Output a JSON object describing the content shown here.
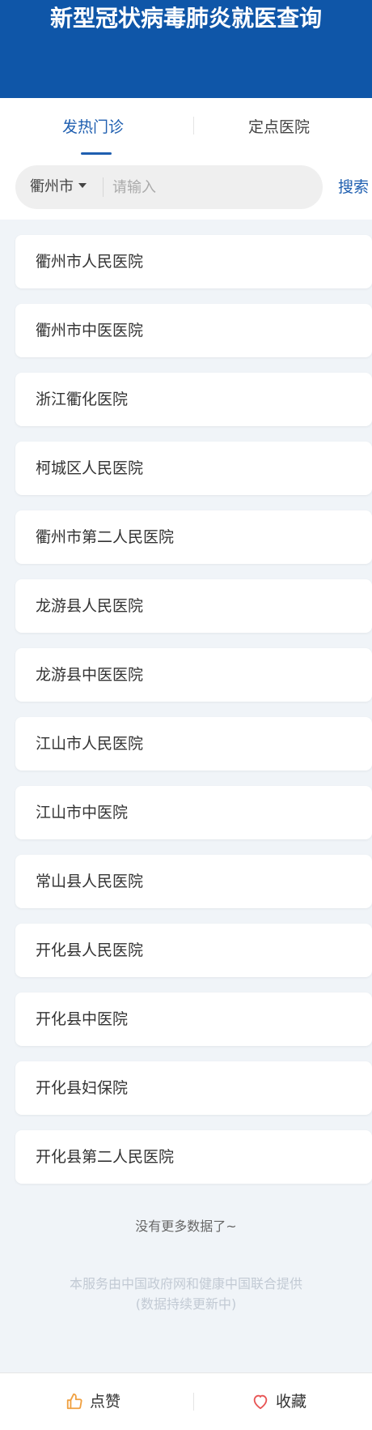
{
  "header": {
    "title": "新型冠状病毒肺炎就医查询"
  },
  "tabs": [
    {
      "label": "发热门诊",
      "active": true
    },
    {
      "label": "定点医院",
      "active": false
    }
  ],
  "search": {
    "city": "衢州市",
    "placeholder": "请输入",
    "value": "",
    "button_label": "搜索"
  },
  "hospitals": [
    "衢州市人民医院",
    "衢州市中医医院",
    "浙江衢化医院",
    "柯城区人民医院",
    "衢州市第二人民医院",
    "龙游县人民医院",
    "龙游县中医医院",
    "江山市人民医院",
    "江山市中医院",
    "常山县人民医院",
    "开化县人民医院",
    "开化县中医院",
    "开化县妇保院",
    "开化县第二人民医院"
  ],
  "list_end_text": "没有更多数据了~",
  "footer": {
    "line1": "本服务由中国政府网和健康中国联合提供",
    "line2": "(数据持续更新中)"
  },
  "bottom_bar": {
    "like_label": "点赞",
    "favorite_label": "收藏"
  },
  "colors": {
    "brand_blue": "#0f56a8",
    "accent_blue": "#1f5fb0",
    "like_icon": "#f0a040",
    "favorite_icon": "#e85555"
  },
  "icons": {
    "like": "thumbs-up-icon",
    "favorite": "heart-icon",
    "city_dropdown": "caret-down-icon"
  }
}
